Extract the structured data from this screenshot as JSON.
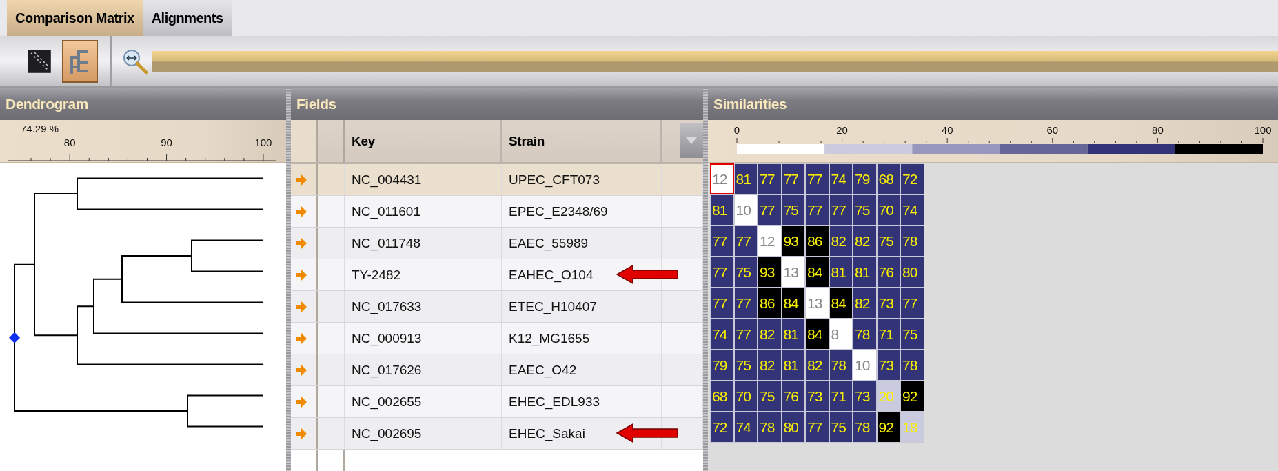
{
  "tabs": [
    {
      "label": "Comparison Matrix",
      "selected": true
    },
    {
      "label": "Alignments",
      "selected": false
    }
  ],
  "toolbar": {
    "buttons": [
      {
        "kind": "matrix",
        "selected": false
      },
      {
        "kind": "tree",
        "selected": true
      }
    ]
  },
  "dendrogram": {
    "title": "Dendrogram",
    "scale_caption": "74.29 %",
    "scale_labels": [
      "80",
      "90",
      "100"
    ]
  },
  "fields": {
    "title": "Fields",
    "columns": [
      "Key",
      "Strain"
    ],
    "rows": [
      {
        "key": "NC_004431",
        "strain": "UPEC_CFT073",
        "selected": true,
        "flagged": false
      },
      {
        "key": "NC_011601",
        "strain": "EPEC_E2348/69",
        "selected": false,
        "flagged": false
      },
      {
        "key": "NC_011748",
        "strain": "EAEC_55989",
        "selected": false,
        "flagged": false
      },
      {
        "key": "TY-2482",
        "strain": "EAHEC_O104",
        "selected": false,
        "flagged": true
      },
      {
        "key": "NC_017633",
        "strain": "ETEC_H10407",
        "selected": false,
        "flagged": false
      },
      {
        "key": "NC_000913",
        "strain": "K12_MG1655",
        "selected": false,
        "flagged": false
      },
      {
        "key": "NC_017626",
        "strain": "EAEC_O42",
        "selected": false,
        "flagged": false
      },
      {
        "key": "NC_002655",
        "strain": "EHEC_EDL933",
        "selected": false,
        "flagged": false
      },
      {
        "key": "NC_002695",
        "strain": "EHEC_Sakai",
        "selected": false,
        "flagged": true
      }
    ]
  },
  "similarities": {
    "title": "Similarities",
    "scale_labels": [
      "0",
      "20",
      "40",
      "60",
      "80",
      "100"
    ],
    "legend": [
      {
        "color": "#ffffff"
      },
      {
        "color": "#cbcbdf"
      },
      {
        "color": "#9898bf"
      },
      {
        "color": "#666699"
      },
      {
        "color": "#333377"
      },
      {
        "color": "#000000"
      }
    ],
    "matrix": [
      [
        {
          "value": "12",
          "color": "#ffffff",
          "selected": true
        },
        {
          "value": "81",
          "color": "#333377",
          "selected": false
        },
        {
          "value": "77",
          "color": "#333377",
          "selected": false
        },
        {
          "value": "77",
          "color": "#333377",
          "selected": false
        },
        {
          "value": "77",
          "color": "#333377",
          "selected": false
        },
        {
          "value": "74",
          "color": "#333377",
          "selected": false
        },
        {
          "value": "79",
          "color": "#333377",
          "selected": false
        },
        {
          "value": "68",
          "color": "#333377",
          "selected": false
        },
        {
          "value": "72",
          "color": "#333377",
          "selected": false
        }
      ],
      [
        {
          "value": "81",
          "color": "#333377",
          "selected": false
        },
        {
          "value": "10",
          "color": "#ffffff",
          "selected": false
        },
        {
          "value": "77",
          "color": "#333377",
          "selected": false
        },
        {
          "value": "75",
          "color": "#333377",
          "selected": false
        },
        {
          "value": "77",
          "color": "#333377",
          "selected": false
        },
        {
          "value": "77",
          "color": "#333377",
          "selected": false
        },
        {
          "value": "75",
          "color": "#333377",
          "selected": false
        },
        {
          "value": "70",
          "color": "#333377",
          "selected": false
        },
        {
          "value": "74",
          "color": "#333377",
          "selected": false
        }
      ],
      [
        {
          "value": "77",
          "color": "#333377",
          "selected": false
        },
        {
          "value": "77",
          "color": "#333377",
          "selected": false
        },
        {
          "value": "12",
          "color": "#ffffff",
          "selected": false
        },
        {
          "value": "93",
          "color": "#000000",
          "selected": false
        },
        {
          "value": "86",
          "color": "#000000",
          "selected": false
        },
        {
          "value": "82",
          "color": "#333377",
          "selected": false
        },
        {
          "value": "82",
          "color": "#333377",
          "selected": false
        },
        {
          "value": "75",
          "color": "#333377",
          "selected": false
        },
        {
          "value": "78",
          "color": "#333377",
          "selected": false
        }
      ],
      [
        {
          "value": "77",
          "color": "#333377",
          "selected": false
        },
        {
          "value": "75",
          "color": "#333377",
          "selected": false
        },
        {
          "value": "93",
          "color": "#000000",
          "selected": false
        },
        {
          "value": "13",
          "color": "#ffffff",
          "selected": false
        },
        {
          "value": "84",
          "color": "#000000",
          "selected": false
        },
        {
          "value": "81",
          "color": "#333377",
          "selected": false
        },
        {
          "value": "81",
          "color": "#333377",
          "selected": false
        },
        {
          "value": "76",
          "color": "#333377",
          "selected": false
        },
        {
          "value": "80",
          "color": "#333377",
          "selected": false
        }
      ],
      [
        {
          "value": "77",
          "color": "#333377",
          "selected": false
        },
        {
          "value": "77",
          "color": "#333377",
          "selected": false
        },
        {
          "value": "86",
          "color": "#000000",
          "selected": false
        },
        {
          "value": "84",
          "color": "#000000",
          "selected": false
        },
        {
          "value": "13",
          "color": "#ffffff",
          "selected": false
        },
        {
          "value": "84",
          "color": "#000000",
          "selected": false
        },
        {
          "value": "82",
          "color": "#333377",
          "selected": false
        },
        {
          "value": "73",
          "color": "#333377",
          "selected": false
        },
        {
          "value": "77",
          "color": "#333377",
          "selected": false
        }
      ],
      [
        {
          "value": "74",
          "color": "#333377",
          "selected": false
        },
        {
          "value": "77",
          "color": "#333377",
          "selected": false
        },
        {
          "value": "82",
          "color": "#333377",
          "selected": false
        },
        {
          "value": "81",
          "color": "#333377",
          "selected": false
        },
        {
          "value": "84",
          "color": "#000000",
          "selected": false
        },
        {
          "value": "8",
          "color": "#ffffff",
          "selected": false
        },
        {
          "value": "78",
          "color": "#333377",
          "selected": false
        },
        {
          "value": "71",
          "color": "#333377",
          "selected": false
        },
        {
          "value": "75",
          "color": "#333377",
          "selected": false
        }
      ],
      [
        {
          "value": "79",
          "color": "#333377",
          "selected": false
        },
        {
          "value": "75",
          "color": "#333377",
          "selected": false
        },
        {
          "value": "82",
          "color": "#333377",
          "selected": false
        },
        {
          "value": "81",
          "color": "#333377",
          "selected": false
        },
        {
          "value": "82",
          "color": "#333377",
          "selected": false
        },
        {
          "value": "78",
          "color": "#333377",
          "selected": false
        },
        {
          "value": "10",
          "color": "#ffffff",
          "selected": false
        },
        {
          "value": "73",
          "color": "#333377",
          "selected": false
        },
        {
          "value": "78",
          "color": "#333377",
          "selected": false
        }
      ],
      [
        {
          "value": "68",
          "color": "#333377",
          "selected": false
        },
        {
          "value": "70",
          "color": "#333377",
          "selected": false
        },
        {
          "value": "75",
          "color": "#333377",
          "selected": false
        },
        {
          "value": "76",
          "color": "#333377",
          "selected": false
        },
        {
          "value": "73",
          "color": "#333377",
          "selected": false
        },
        {
          "value": "71",
          "color": "#333377",
          "selected": false
        },
        {
          "value": "73",
          "color": "#333377",
          "selected": false
        },
        {
          "value": "20",
          "color": "#cbcbdf",
          "selected": false
        },
        {
          "value": "92",
          "color": "#000000",
          "selected": false
        }
      ],
      [
        {
          "value": "72",
          "color": "#333377",
          "selected": false
        },
        {
          "value": "74",
          "color": "#333377",
          "selected": false
        },
        {
          "value": "78",
          "color": "#333377",
          "selected": false
        },
        {
          "value": "80",
          "color": "#333377",
          "selected": false
        },
        {
          "value": "77",
          "color": "#333377",
          "selected": false
        },
        {
          "value": "75",
          "color": "#333377",
          "selected": false
        },
        {
          "value": "78",
          "color": "#333377",
          "selected": false
        },
        {
          "value": "92",
          "color": "#000000",
          "selected": false
        },
        {
          "value": "18",
          "color": "#cbcbdf",
          "selected": false
        }
      ]
    ]
  }
}
